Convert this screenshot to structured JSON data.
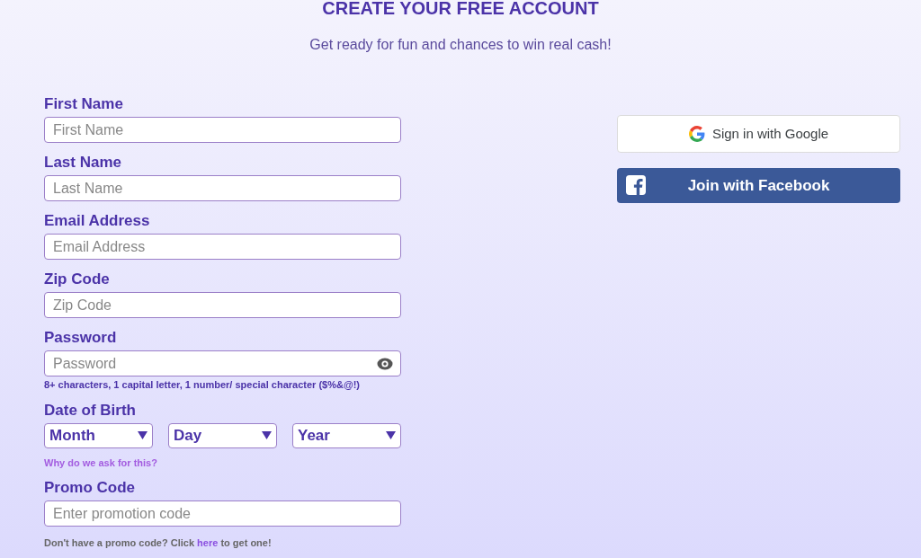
{
  "title": "CREATE YOUR FREE ACCOUNT",
  "subtitle": "Get ready for fun and chances to win real cash!",
  "fields": [
    {
      "kind": "text",
      "label": "First Name",
      "placeholder": "First Name"
    },
    {
      "kind": "text",
      "label": "Last Name",
      "placeholder": "Last Name"
    },
    {
      "kind": "text",
      "label": "Email Address",
      "placeholder": "Email Address"
    },
    {
      "kind": "text",
      "label": "Zip Code",
      "placeholder": "Zip Code"
    },
    {
      "kind": "password",
      "label": "Password",
      "placeholder": "Password",
      "hint": "8+ characters, 1 capital letter, 1 number/ special character ($%&@!)"
    },
    {
      "kind": "date",
      "label": "Date of Birth",
      "selects": [
        "Month",
        "Day",
        "Year"
      ],
      "link": "Why do we ask for this?"
    },
    {
      "kind": "text",
      "label": "Promo Code",
      "placeholder": "Enter promotion code"
    }
  ],
  "promo_note": {
    "before": "Don't have a promo code? Click ",
    "link": "here",
    "after": " to get one!"
  },
  "social": [
    {
      "kind": "google",
      "label": "Sign in with Google"
    },
    {
      "kind": "facebook",
      "label": "Join with Facebook"
    }
  ]
}
